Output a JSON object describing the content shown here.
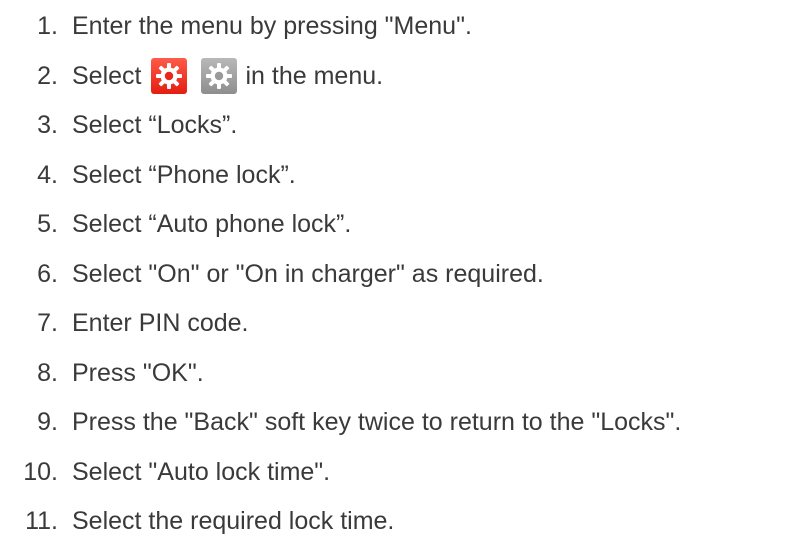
{
  "steps": [
    {
      "num": "1.",
      "text": "Enter the menu by pressing \"Menu\"."
    },
    {
      "num": "2.",
      "pre": "Select",
      "post": "in the menu.",
      "icons": [
        "settings-red-icon",
        "settings-gray-icon"
      ]
    },
    {
      "num": "3.",
      "text": "Select “Locks”."
    },
    {
      "num": "4.",
      "text": "Select “Phone lock”."
    },
    {
      "num": "5.",
      "text": "Select “Auto phone lock”."
    },
    {
      "num": "6.",
      "text": "Select \"On\" or \"On in charger\" as required."
    },
    {
      "num": "7.",
      "text": "Enter PIN code."
    },
    {
      "num": "8.",
      "text": "Press \"OK\"."
    },
    {
      "num": "9.",
      "text": "Press the \"Back\" soft key twice to return to the \"Locks\"."
    },
    {
      "num": "10.",
      "text": "Select \"Auto lock time\"."
    },
    {
      "num": "11.",
      "text": "Select the required lock time."
    }
  ],
  "colors": {
    "text": "#3a3a3a",
    "icon_red": "#e8261a",
    "icon_gray": "#9a9a9a"
  }
}
